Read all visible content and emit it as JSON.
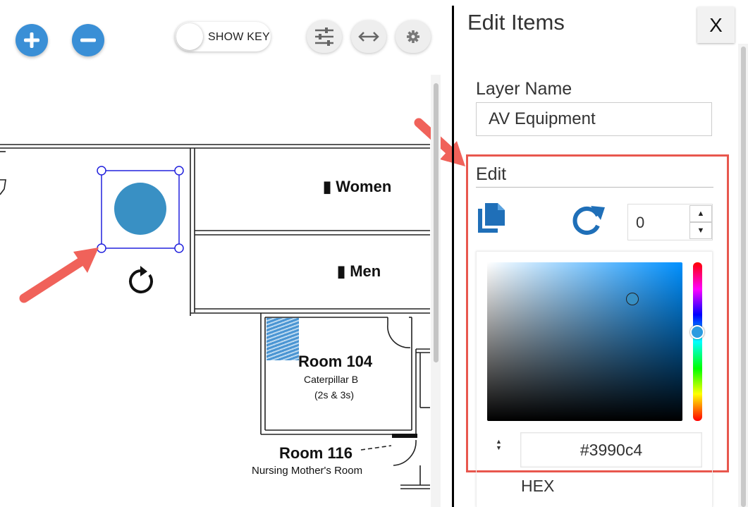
{
  "toolbar": {
    "show_key_label": "SHOW KEY",
    "zoom_in_icon": "plus-icon",
    "zoom_out_icon": "minus-icon",
    "filter_icon": "sliders-icon",
    "resize_icon": "horizontal-arrows-icon",
    "settings_icon": "gear-icon",
    "accent_color": "#3a8fd6"
  },
  "map": {
    "rooms": [
      {
        "name": "Women"
      },
      {
        "name": "Men"
      },
      {
        "name": "Room 104",
        "subtitle": "Caterpillar B",
        "detail": "(2s & 3s)"
      },
      {
        "name": "Room 116",
        "subtitle": "Nursing Mother's Room"
      }
    ],
    "selected_item_color": "#3990c4",
    "selection_color": "#2222dd"
  },
  "panel": {
    "title": "Edit Items",
    "close_label": "X",
    "layer_name_label": "Layer Name",
    "layer_name_value": "AV Equipment",
    "edit_label": "Edit",
    "rotation_value": "0",
    "spin_up": "▲",
    "spin_down": "▼",
    "hex_toggle": "▲▼",
    "hex_value": "#3990c4",
    "hex_label": "HEX",
    "highlight_color": "#e8574e"
  }
}
